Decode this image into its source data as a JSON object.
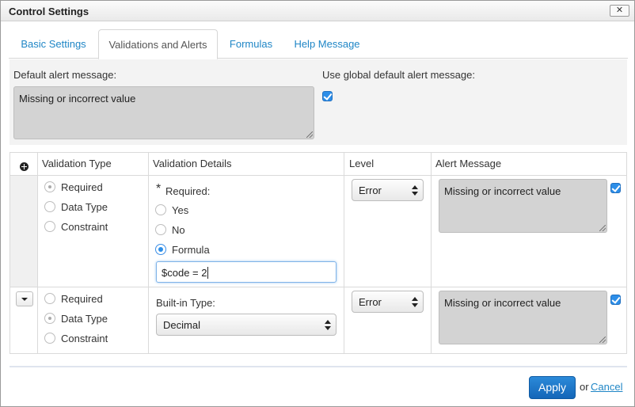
{
  "window": {
    "title": "Control Settings",
    "close_label": "✕"
  },
  "tabs": [
    {
      "label": "Basic Settings"
    },
    {
      "label": "Validations and Alerts"
    },
    {
      "label": "Formulas"
    },
    {
      "label": "Help Message"
    }
  ],
  "defaults": {
    "default_alert_label": "Default alert message:",
    "default_alert_value": "Missing or incorrect value",
    "use_global_label": "Use global default alert message:",
    "use_global_checked": true
  },
  "table": {
    "headers": {
      "validation_type": "Validation Type",
      "validation_details": "Validation Details",
      "level": "Level",
      "alert_message": "Alert Message"
    },
    "rows": [
      {
        "type_options": [
          "Required",
          "Data Type",
          "Constraint"
        ],
        "selected_type": "Required",
        "details": {
          "required_star": "*",
          "required_label": "Required:",
          "options": [
            "Yes",
            "No",
            "Formula"
          ],
          "selected": "Formula",
          "formula_value": "$code = 2"
        },
        "level": "Error",
        "alert_message": "Missing or incorrect value",
        "alert_checked": true
      },
      {
        "type_options": [
          "Required",
          "Data Type",
          "Constraint"
        ],
        "selected_type": "Data Type",
        "details": {
          "builtin_label": "Built-in Type:",
          "builtin_value": "Decimal"
        },
        "level": "Error",
        "alert_message": "Missing or incorrect value",
        "alert_checked": true
      }
    ]
  },
  "footer": {
    "apply_label": "Apply",
    "or_text": "or",
    "cancel_label": "Cancel"
  },
  "colors": {
    "accent": "#1f86c6",
    "primary_button": "#1a73c9"
  },
  "icons": {
    "add": "plus-circle-icon",
    "row_menu": "chevron-down-icon",
    "close": "close-icon"
  }
}
